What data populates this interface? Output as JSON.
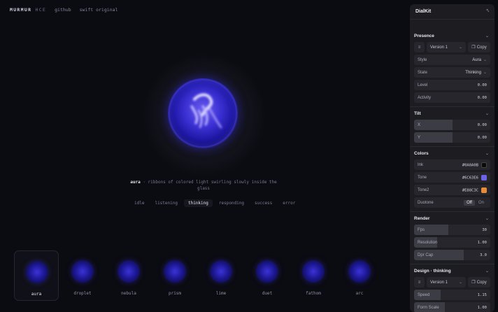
{
  "nav": {
    "brand": "MURMUR",
    "brand_suffix": "HCE",
    "links": [
      "github",
      "swift original"
    ]
  },
  "hero": {
    "name": "aura",
    "description": "· ribbons of colored light swirling slowly inside the glass"
  },
  "states": {
    "items": [
      "idle",
      "listening",
      "thinking",
      "responding",
      "success",
      "error"
    ],
    "active": "thinking"
  },
  "gallery": [
    "aura",
    "droplet",
    "nebula",
    "prism",
    "lime",
    "duet",
    "fathom",
    "arc"
  ],
  "panel": {
    "title": "DialKit",
    "presence": {
      "title": "Presence",
      "version": "Version 1",
      "copy": "Copy",
      "style": {
        "label": "Style",
        "value": "Aura"
      },
      "state": {
        "label": "State",
        "value": "Thinking"
      },
      "level": {
        "label": "Level",
        "value": "0.00"
      },
      "activity": {
        "label": "Activity",
        "value": "0.00"
      }
    },
    "tilt": {
      "title": "Tilt",
      "x": {
        "label": "X",
        "value": "0.00",
        "fill": 0.5
      },
      "y": {
        "label": "Y",
        "value": "0.00",
        "fill": 0.5
      }
    },
    "colors": {
      "title": "Colors",
      "ink": {
        "label": "Ink",
        "value": "#0A0A0B",
        "color": "#0A0A0B"
      },
      "tone": {
        "label": "Tone",
        "value": "#6C63E6",
        "color": "#6C63E6"
      },
      "tone2": {
        "label": "Tone2",
        "value": "#E88C3C",
        "color": "#E88C3C"
      },
      "duotone": {
        "label": "Duotone",
        "off": "Off",
        "on": "On",
        "selected": "Off"
      }
    },
    "render": {
      "title": "Render",
      "fps": {
        "label": "Fps",
        "value": "30",
        "fill": 0.45
      },
      "resolution": {
        "label": "Resolution",
        "value": "1.00",
        "fill": 0.3
      },
      "dpr": {
        "label": "Dpr Cap",
        "value": "3.0",
        "fill": 0.65
      }
    },
    "design": {
      "title": "Design · thinking",
      "version": "Version 1",
      "copy": "Copy",
      "speed": {
        "label": "Speed",
        "value": "1.15",
        "fill": 0.35
      },
      "form_scale": {
        "label": "Form Scale",
        "value": "1.00",
        "fill": 0.4
      }
    }
  }
}
